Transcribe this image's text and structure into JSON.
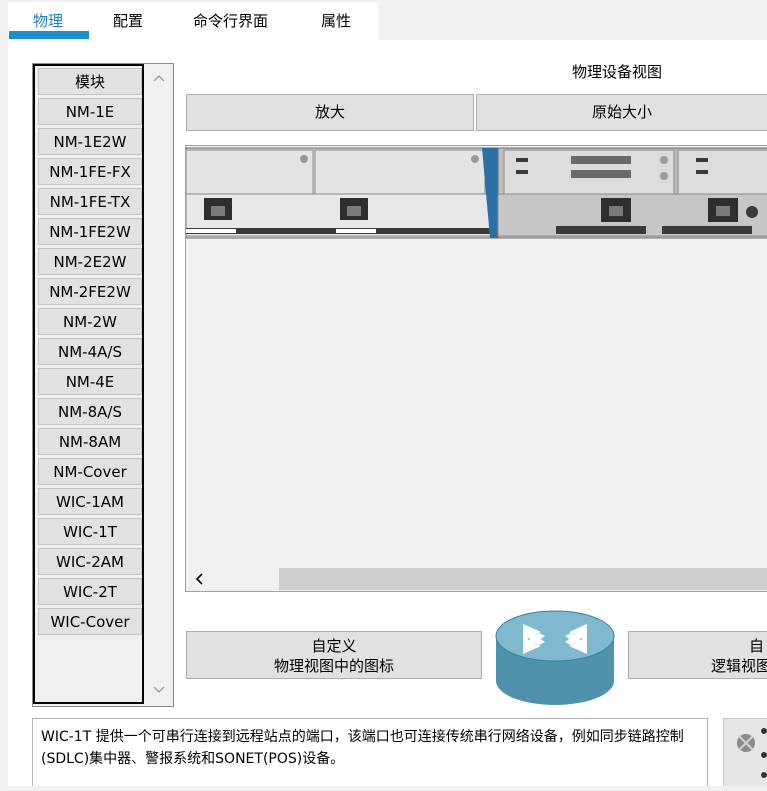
{
  "tabs": [
    {
      "label": "物理"
    },
    {
      "label": "配置"
    },
    {
      "label": "命令行界面"
    },
    {
      "label": "属性"
    }
  ],
  "modules": {
    "header": "模块",
    "items": [
      "NM-1E",
      "NM-1E2W",
      "NM-1FE-FX",
      "NM-1FE-TX",
      "NM-1FE2W",
      "NM-2E2W",
      "NM-2FE2W",
      "NM-2W",
      "NM-4A/S",
      "NM-4E",
      "NM-8A/S",
      "NM-8AM",
      "NM-Cover",
      "WIC-1AM",
      "WIC-1T",
      "WIC-2AM",
      "WIC-2T",
      "WIC-Cover"
    ]
  },
  "physical_view": {
    "title": "物理设备视图",
    "zoom_in": "放大",
    "original_size": "原始大小"
  },
  "custom_buttons": {
    "physical_line1": "自定义",
    "physical_line2": "物理视图中的图标",
    "logical_line1": "自",
    "logical_line2": "逻辑视图"
  },
  "description": "WIC-1T 提供一个可串行连接到远程站点的端口，该端口也可连接传统串行网络设备，例如同步链路控制(SDLC)集中器、警报系统和SONET(POS)设备。"
}
